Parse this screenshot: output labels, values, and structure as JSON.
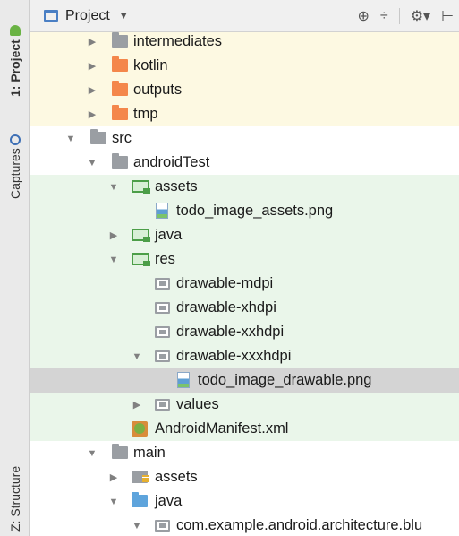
{
  "sidebar": {
    "project_label": "1: Project",
    "captures_label": "Captures",
    "structure_label": "Z: Structure"
  },
  "header": {
    "title": "Project",
    "dropdown_caret": "▼",
    "tools": [
      "⊕",
      "÷",
      "⚙▾",
      "⊢"
    ]
  },
  "tree": {
    "rows": [
      {
        "label": "intermediates",
        "state": "collapsed"
      },
      {
        "label": "kotlin",
        "state": "collapsed"
      },
      {
        "label": "outputs",
        "state": "collapsed"
      },
      {
        "label": "tmp",
        "state": "collapsed"
      },
      {
        "label": "src",
        "state": "expanded"
      },
      {
        "label": "androidTest",
        "state": "expanded"
      },
      {
        "label": "assets",
        "state": "expanded"
      },
      {
        "label": "todo_image_assets.png",
        "state": "leaf"
      },
      {
        "label": "java",
        "state": "collapsed"
      },
      {
        "label": "res",
        "state": "expanded"
      },
      {
        "label": "drawable-mdpi",
        "state": "leaf"
      },
      {
        "label": "drawable-xhdpi",
        "state": "leaf"
      },
      {
        "label": "drawable-xxhdpi",
        "state": "leaf"
      },
      {
        "label": "drawable-xxxhdpi",
        "state": "expanded"
      },
      {
        "label": "todo_image_drawable.png",
        "state": "selected"
      },
      {
        "label": "values",
        "state": "collapsed"
      },
      {
        "label": "AndroidManifest.xml",
        "state": "leaf"
      },
      {
        "label": "main",
        "state": "expanded"
      },
      {
        "label": "assets",
        "state": "collapsed"
      },
      {
        "label": "java",
        "state": "expanded"
      },
      {
        "label": "com.example.android.architecture.blu",
        "state": "expanded"
      }
    ]
  },
  "glyphs": {
    "expanded": "▼",
    "collapsed": "▶"
  },
  "colors": {
    "excluded_bg": "#fdf9e2",
    "test_bg": "#eaf6ea",
    "selected_bg": "#d4d4d4",
    "excluded_folder": "#f4874b",
    "source_folder": "#5ea4dc",
    "test_folder": "#4c9e48"
  }
}
